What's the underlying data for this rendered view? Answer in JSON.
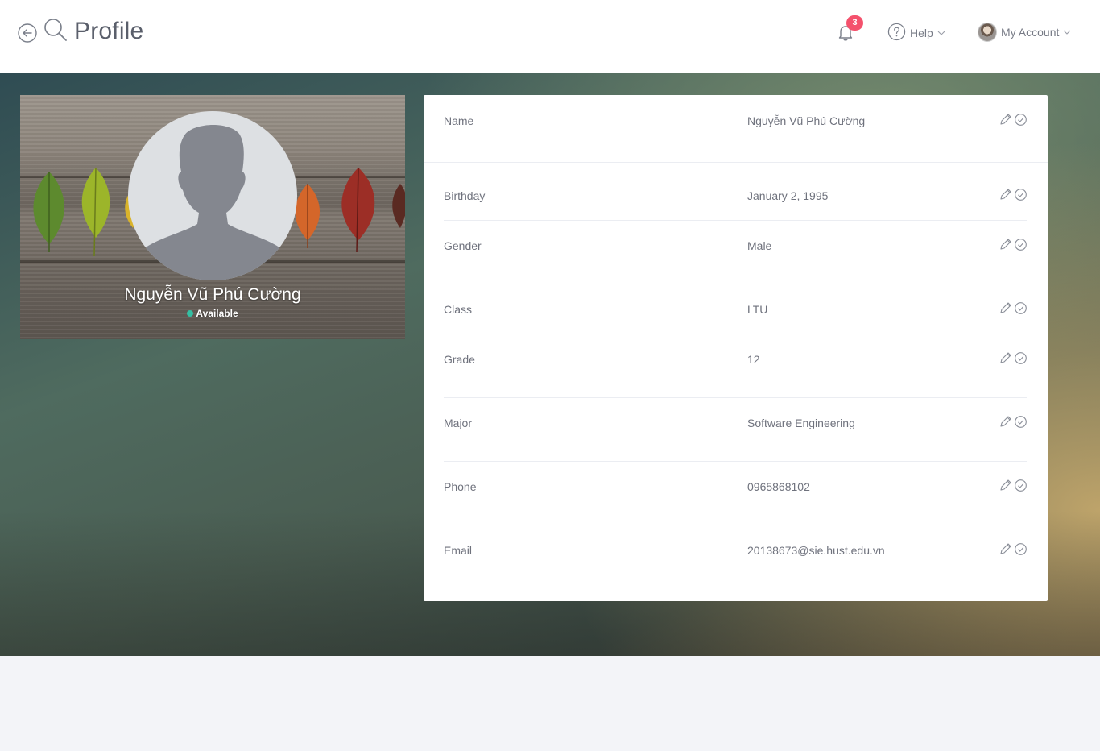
{
  "header": {
    "title": "Profile",
    "notification_count": "3",
    "help_label": "Help",
    "account_label": "My Account"
  },
  "profile": {
    "name": "Nguyễn Vũ Phú Cường",
    "status": "Available",
    "status_color": "#34bfa3"
  },
  "fields": [
    {
      "label": "Name",
      "value": "Nguyễn Vũ Phú Cường"
    },
    {
      "label": "Birthday",
      "value": "January 2, 1995"
    },
    {
      "label": "Gender",
      "value": "Male"
    },
    {
      "label": "Class",
      "value": "LTU"
    },
    {
      "label": "Grade",
      "value": "12"
    },
    {
      "label": "Major",
      "value": "Software Engineering"
    },
    {
      "label": "Phone",
      "value": "0965868102"
    },
    {
      "label": "Email",
      "value": "20138673@sie.hust.edu.vn"
    }
  ],
  "colors": {
    "badge": "#f4516c",
    "text_muted": "#6f727d",
    "page_bg": "#f3f4f8"
  },
  "icons": {
    "back": "back-arrow-icon",
    "search": "search-icon",
    "notifications": "bell-icon",
    "help": "question-circle-icon",
    "edit": "pencil-icon",
    "confirm": "check-circle-icon"
  }
}
